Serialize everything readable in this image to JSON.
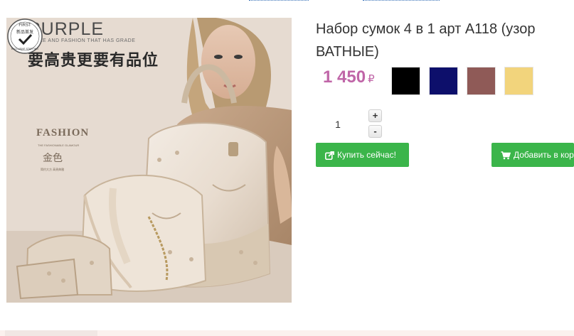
{
  "product": {
    "title": "Набор сумок 4 в 1 арт А118 (узор ВАТНЫЕ)",
    "price": "1 450",
    "currency": "₽",
    "image": {
      "brand": "PURPLE",
      "tagline": "NOBLE AND FASHION THAT HAS GRADE",
      "headline_cn": "要高贵更要有品位",
      "badge_top": "FIRST",
      "badge_mid": "新品首发",
      "badge_bottom": "EXCLUSIVE STARTING",
      "fashion": "FASHION",
      "fashion_sub": "THE FASHIONABLE GLAMOUR",
      "color_cn": "金色",
      "color_sub": "简约大方 高贵典雅"
    }
  },
  "swatches": [
    {
      "name": "black",
      "color": "#000000"
    },
    {
      "name": "navy",
      "color": "#0d0f6b"
    },
    {
      "name": "rose-brown",
      "color": "#8f5a57"
    },
    {
      "name": "light-yellow",
      "color": "#f2d47c"
    }
  ],
  "quantity": {
    "value": "1",
    "plus": "+",
    "minus": "-"
  },
  "buttons": {
    "buy_now": "Купить сейчас!",
    "add_to_cart": "Добавить в корзину"
  },
  "colors": {
    "price": "#c066a8",
    "button": "#3bb54a"
  }
}
